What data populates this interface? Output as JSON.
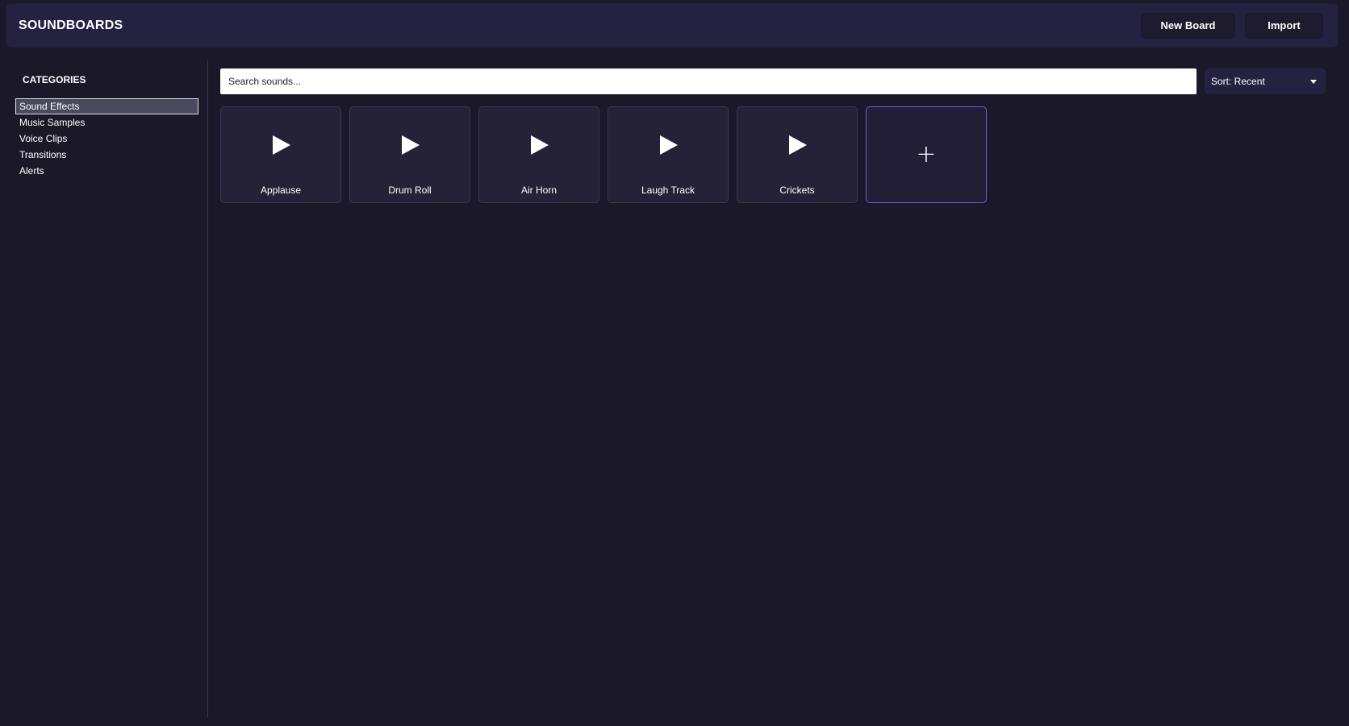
{
  "header": {
    "title": "SOUNDBOARDS",
    "new_board_label": "New Board",
    "import_label": "Import"
  },
  "sidebar": {
    "heading": "CATEGORIES",
    "items": [
      {
        "label": "Sound Effects",
        "active": true
      },
      {
        "label": "Music Samples"
      },
      {
        "label": "Voice Clips"
      },
      {
        "label": "Transitions"
      },
      {
        "label": "Alerts"
      }
    ]
  },
  "main": {
    "search": {
      "placeholder": "Search sounds...",
      "value": ""
    },
    "sort": {
      "label": "Sort: Recent"
    },
    "sounds": [
      {
        "name": "Applause",
        "icon": "play-icon"
      },
      {
        "name": "Drum Roll",
        "icon": "play-icon"
      },
      {
        "name": "Air Horn",
        "icon": "play-icon"
      },
      {
        "name": "Laugh Track",
        "icon": "play-icon"
      },
      {
        "name": "Crickets",
        "icon": "play-icon"
      }
    ],
    "add_tile": {
      "symbol": "+",
      "icon": "plus-icon"
    }
  },
  "colors": {
    "background": "#1b1829",
    "header": "#252241",
    "tile": "#252238",
    "accent": "#6b5bd6"
  }
}
